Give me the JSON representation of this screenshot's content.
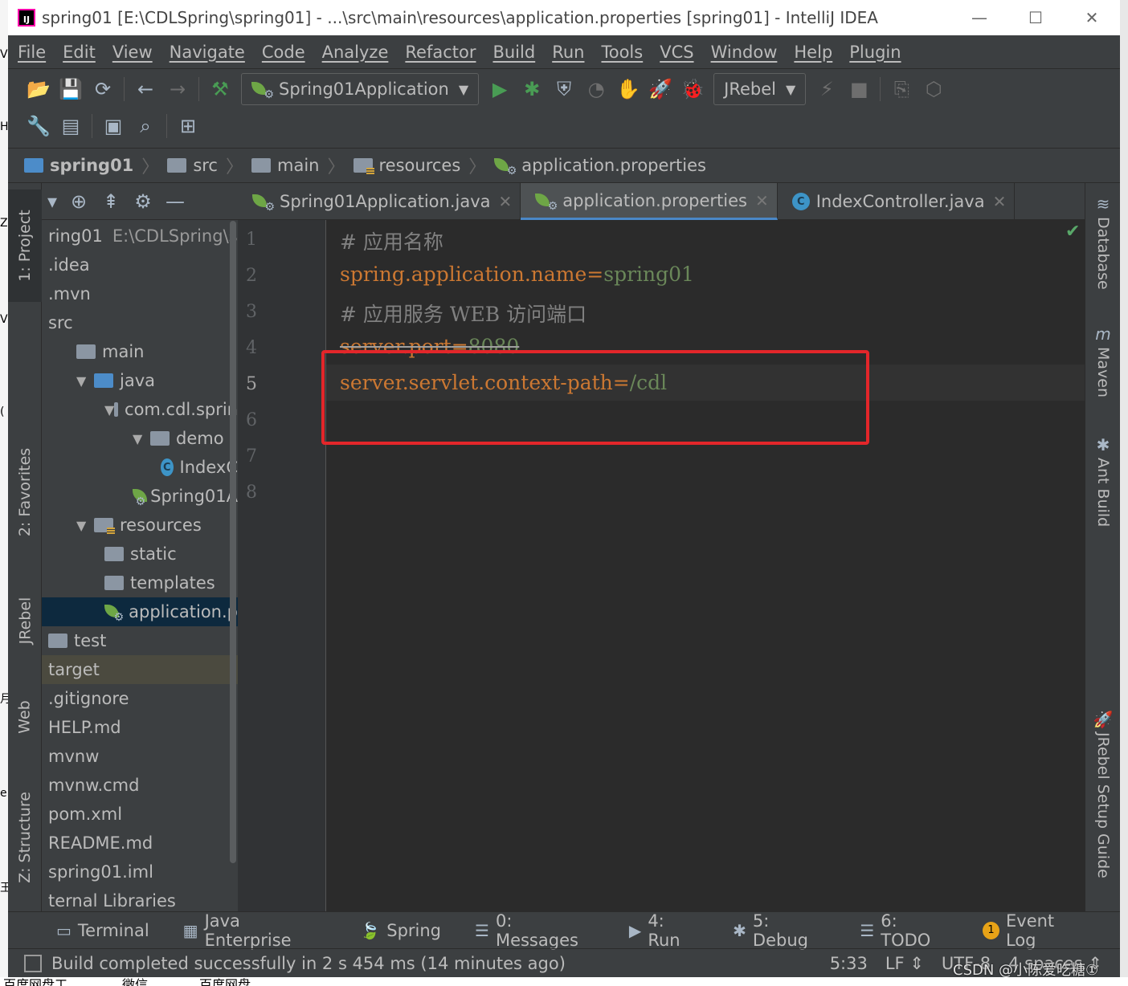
{
  "window": {
    "title": "spring01 [E:\\CDLSpring\\spring01] - ...\\src\\main\\resources\\application.properties [spring01] - IntelliJ IDEA",
    "logo": "IJ",
    "minimize": "—",
    "maximize": "☐",
    "close": "✕"
  },
  "menu": [
    "File",
    "Edit",
    "View",
    "Navigate",
    "Code",
    "Analyze",
    "Refactor",
    "Build",
    "Run",
    "Tools",
    "VCS",
    "Window",
    "Help",
    "Plugin"
  ],
  "toolbar": {
    "run_config": "Spring01Application",
    "jrebel": "JRebel"
  },
  "breadcrumb": [
    {
      "label": "spring01",
      "icon": "module-folder-icon"
    },
    {
      "label": "src",
      "icon": "folder-icon"
    },
    {
      "label": "main",
      "icon": "folder-icon"
    },
    {
      "label": "resources",
      "icon": "resources-folder-icon"
    },
    {
      "label": "application.properties",
      "icon": "spring-properties-icon"
    }
  ],
  "left_stripe": [
    "1: Project",
    "2: Favorites",
    "JRebel",
    "Web",
    "Z: Structure"
  ],
  "right_stripe": [
    "Database",
    "Maven",
    "Ant Build",
    "JRebel Setup Guide"
  ],
  "project_tree": [
    {
      "label": "ring01",
      "suffix": "E:\\CDLSpring\\spr",
      "indent": 0,
      "icon": "",
      "arrow": ""
    },
    {
      "label": ".idea",
      "indent": 0,
      "icon": "",
      "arrow": ""
    },
    {
      "label": ".mvn",
      "indent": 0,
      "icon": "",
      "arrow": ""
    },
    {
      "label": "src",
      "indent": 0,
      "icon": "",
      "arrow": ""
    },
    {
      "label": "main",
      "indent": 1,
      "icon": "folder",
      "arrow": ""
    },
    {
      "label": "java",
      "indent": 1,
      "icon": "folder-blue",
      "arrow": "▼"
    },
    {
      "label": "com.cdl.sprin",
      "indent": 2,
      "icon": "folder",
      "arrow": "▼"
    },
    {
      "label": "demo",
      "indent": 3,
      "icon": "folder",
      "arrow": "▼"
    },
    {
      "label": "IndexC",
      "indent": 4,
      "icon": "class",
      "arrow": ""
    },
    {
      "label": "Spring01A",
      "indent": 3,
      "icon": "spring",
      "arrow": ""
    },
    {
      "label": "resources",
      "indent": 1,
      "icon": "folder-res",
      "arrow": "▼"
    },
    {
      "label": "static",
      "indent": 2,
      "icon": "folder",
      "arrow": ""
    },
    {
      "label": "templates",
      "indent": 2,
      "icon": "folder",
      "arrow": ""
    },
    {
      "label": "application.p",
      "indent": 2,
      "icon": "spring",
      "arrow": "",
      "selected": true
    },
    {
      "label": "test",
      "indent": 0,
      "icon": "folder",
      "arrow": ""
    },
    {
      "label": "target",
      "indent": 0,
      "icon": "",
      "arrow": "",
      "highlight": true
    },
    {
      "label": ".gitignore",
      "indent": 0,
      "icon": "",
      "arrow": ""
    },
    {
      "label": "HELP.md",
      "indent": 0,
      "icon": "",
      "arrow": ""
    },
    {
      "label": "mvnw",
      "indent": 0,
      "icon": "",
      "arrow": ""
    },
    {
      "label": "mvnw.cmd",
      "indent": 0,
      "icon": "",
      "arrow": ""
    },
    {
      "label": "pom.xml",
      "indent": 0,
      "icon": "",
      "arrow": ""
    },
    {
      "label": "README.md",
      "indent": 0,
      "icon": "",
      "arrow": ""
    },
    {
      "label": "spring01.iml",
      "indent": 0,
      "icon": "",
      "arrow": ""
    },
    {
      "label": "ternal Libraries",
      "indent": 0,
      "icon": "",
      "arrow": ""
    }
  ],
  "tabs": [
    {
      "label": "Spring01Application.java",
      "icon": "spring",
      "active": false
    },
    {
      "label": "application.properties",
      "icon": "spring",
      "active": true
    },
    {
      "label": "IndexController.java",
      "icon": "class",
      "active": false
    }
  ],
  "tab_close": "✕",
  "line_numbers": [
    "1",
    "2",
    "3",
    "4",
    "5",
    "6",
    "7",
    "8"
  ],
  "code": {
    "line1": "# 应用名称",
    "line2_key": "spring.application.name",
    "line2_eq": "=",
    "line2_val": "spring01",
    "line3": "# 应用服务 WEB 访问端口",
    "line4_key": "server.port",
    "line4_eq": "=",
    "line4_val": "8080",
    "line5_key": "server.servlet.context-path",
    "line5_eq": "=",
    "line5_val": "/cdl"
  },
  "bottom_tools": [
    {
      "label": "Terminal",
      "icon": "terminal-icon",
      "glyph": "▭"
    },
    {
      "label": "Java Enterprise",
      "icon": "java-enterprise-icon",
      "glyph": "▦"
    },
    {
      "label": "Spring",
      "icon": "spring-icon",
      "glyph": "🍃"
    },
    {
      "label": "0: Messages",
      "icon": "messages-icon",
      "glyph": "☰"
    },
    {
      "label": "4: Run",
      "icon": "run-icon",
      "glyph": "▶"
    },
    {
      "label": "5: Debug",
      "icon": "debug-icon",
      "glyph": "✱"
    },
    {
      "label": "6: TODO",
      "icon": "todo-icon",
      "glyph": "☰"
    }
  ],
  "event_log": {
    "label": "Event Log",
    "count": "1"
  },
  "status": {
    "message": "Build completed successfully in 2 s 454 ms (14 minutes ago)",
    "position": "5:33",
    "line_sep": "LF ⇕",
    "encoding": "UTF-8",
    "indent": "4 spaces ⇕"
  },
  "watermark": "CSDN @小陈爱吃糖①",
  "taskbar": [
    "百度网盘工",
    "微信",
    "百度网盘"
  ],
  "colors": {
    "keyword": "#cc7832",
    "value": "#6a8759",
    "comment": "#808080",
    "highlight_box": "#e3262a",
    "editor_bg": "#2b2b2b"
  }
}
